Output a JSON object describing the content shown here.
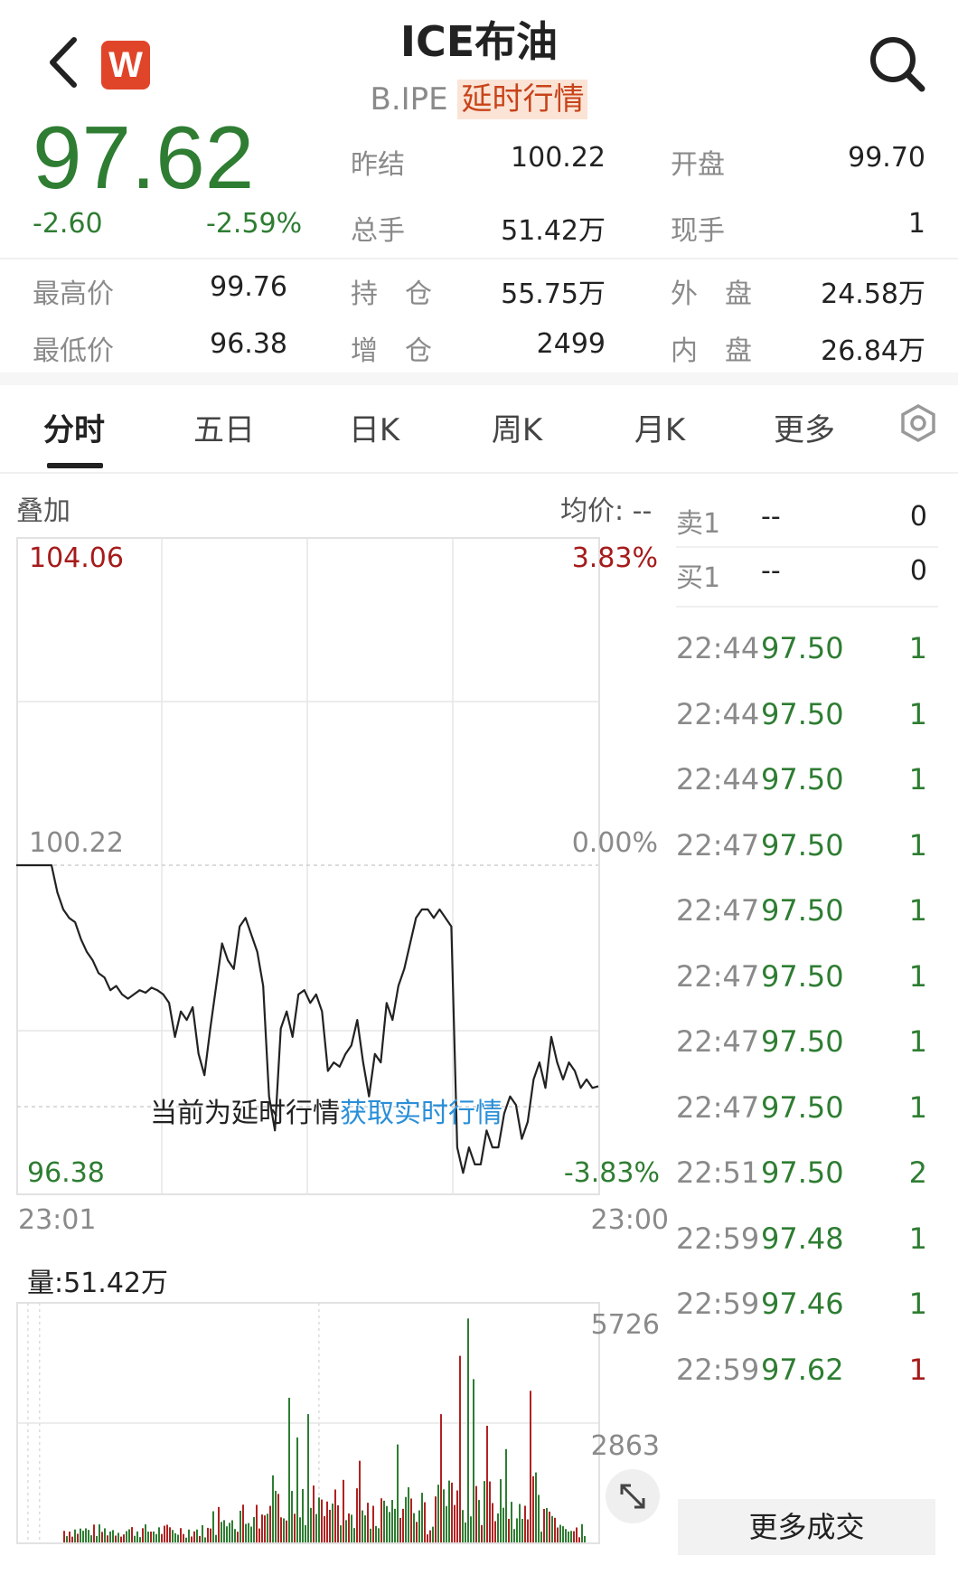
{
  "header": {
    "title": "ICE布油",
    "code": "B.IPE",
    "delay_tag": "延时行情",
    "logo_letter": "W"
  },
  "quote": {
    "price": "97.62",
    "change": "-2.60",
    "change_pct": "-2.59%",
    "fields": [
      {
        "label": "昨结",
        "value": "100.22"
      },
      {
        "label": "开盘",
        "value": "99.70"
      },
      {
        "label": "总手",
        "value": "51.42万"
      },
      {
        "label": "现手",
        "value": "1"
      },
      {
        "label": "最高价",
        "value": "99.76"
      },
      {
        "label": "持　仓",
        "value": "55.75万"
      },
      {
        "label": "外　盘",
        "value": "24.58万"
      },
      {
        "label": "最低价",
        "value": "96.38"
      },
      {
        "label": "增　仓",
        "value": "2499"
      },
      {
        "label": "内　盘",
        "value": "26.84万"
      }
    ]
  },
  "tabs": [
    "分时",
    "五日",
    "日K",
    "周K",
    "月K",
    "更多"
  ],
  "chart_panel": {
    "overlay_label": "叠加",
    "avg_label": "均价: --",
    "price_high": "104.06",
    "pct_high": "3.83%",
    "price_mid": "100.22",
    "pct_mid": "0.00%",
    "price_low": "96.38",
    "pct_low": "-3.83%",
    "time_start": "23:01",
    "time_end": "23:00",
    "delay_notice": "当前为延时行情",
    "realtime_link": "获取实时行情",
    "volume_label": "量:51.42万",
    "vol_high": "5726",
    "vol_mid": "2863"
  },
  "orderbook": [
    {
      "label": "卖1",
      "price": "--",
      "vol": "0"
    },
    {
      "label": "买1",
      "price": "--",
      "vol": "0"
    }
  ],
  "trades": [
    {
      "time": "22:44",
      "price": "97.50",
      "vol": "1",
      "dir": "up"
    },
    {
      "time": "22:44",
      "price": "97.50",
      "vol": "1",
      "dir": "up"
    },
    {
      "time": "22:44",
      "price": "97.50",
      "vol": "1",
      "dir": "up"
    },
    {
      "time": "22:47",
      "price": "97.50",
      "vol": "1",
      "dir": "up"
    },
    {
      "time": "22:47",
      "price": "97.50",
      "vol": "1",
      "dir": "up"
    },
    {
      "time": "22:47",
      "price": "97.50",
      "vol": "1",
      "dir": "up"
    },
    {
      "time": "22:47",
      "price": "97.50",
      "vol": "1",
      "dir": "up"
    },
    {
      "time": "22:47",
      "price": "97.50",
      "vol": "1",
      "dir": "up"
    },
    {
      "time": "22:51",
      "price": "97.50",
      "vol": "2",
      "dir": "up"
    },
    {
      "time": "22:59",
      "price": "97.48",
      "vol": "1",
      "dir": "up"
    },
    {
      "time": "22:59",
      "price": "97.46",
      "vol": "1",
      "dir": "up"
    },
    {
      "time": "22:59",
      "price": "97.62",
      "vol": "1",
      "dir": "down"
    }
  ],
  "more_trades_label": "更多成交",
  "colors": {
    "up": "#a61b1b",
    "down": "#2e7d32",
    "link": "#2a8fd8"
  },
  "chart_data": {
    "type": "line",
    "ylim": [
      96.38,
      104.06
    ],
    "reference": 100.22,
    "price_path": [
      100.22,
      100.22,
      100.22,
      100.22,
      100.22,
      100.22,
      100.22,
      99.9,
      99.7,
      99.6,
      99.55,
      99.35,
      99.2,
      99.1,
      98.95,
      98.9,
      98.75,
      98.8,
      98.7,
      98.65,
      98.7,
      98.75,
      98.72,
      98.78,
      98.75,
      98.7,
      98.6,
      98.2,
      98.5,
      98.4,
      98.55,
      98.0,
      97.75,
      98.3,
      98.8,
      99.3,
      99.1,
      99.0,
      99.5,
      99.6,
      99.4,
      99.2,
      98.8,
      97.5,
      97.1,
      98.3,
      98.5,
      98.2,
      98.7,
      98.75,
      98.6,
      98.7,
      98.5,
      97.8,
      97.9,
      97.85,
      98.0,
      98.1,
      98.4,
      97.9,
      97.5,
      98.0,
      97.9,
      98.6,
      98.4,
      98.8,
      99.0,
      99.3,
      99.6,
      99.7,
      99.7,
      99.6,
      99.7,
      99.6,
      99.5,
      96.9,
      96.6,
      96.9,
      96.7,
      96.7,
      97.1,
      96.9,
      96.9,
      97.3,
      97.5,
      97.4,
      97.0,
      97.2,
      97.7,
      97.9,
      97.6,
      98.2,
      97.9,
      97.7,
      97.9,
      97.8,
      97.6,
      97.7,
      97.6,
      97.62
    ],
    "volume_max": 5726,
    "volume_mid": 2863
  }
}
